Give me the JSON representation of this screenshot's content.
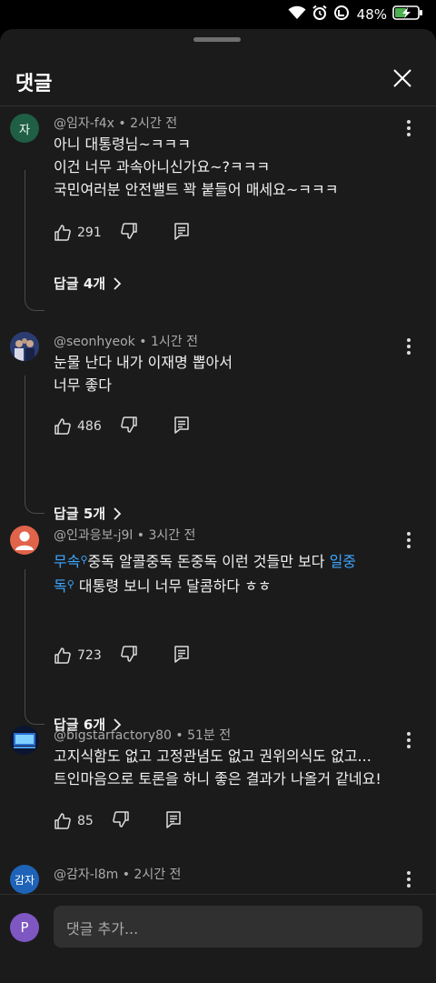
{
  "status_bar": {
    "battery": "48%"
  },
  "sheet": {
    "title": "댓글",
    "input_placeholder": "댓글 추가...",
    "input_avatar_letter": "P"
  },
  "comments": [
    {
      "avatar_letter": "자",
      "author": "@임자-f4x",
      "time": "2시간 전",
      "lines": [
        "아니 대통령님~ㅋㅋㅋ",
        "이건 너무 과속아니신가요~?ㅋㅋㅋ",
        "국민여러분 안전밸트 꽉 붙들어 매세요~ㅋㅋㅋ"
      ],
      "likes": "291",
      "replies": "답글 4개"
    },
    {
      "avatar_letter": "",
      "author": "@seonhyeok",
      "time": "1시간 전",
      "lines": [
        "눈물 난다 내가 이재명 뽑아서",
        "너무 좋다"
      ],
      "likes": "486",
      "replies": "답글 5개"
    },
    {
      "avatar_letter": "",
      "author": "@인과응보-j9l",
      "time": "3시간 전",
      "tag1": "무속",
      "text_mid": "중독 알콜중독 돈중독 이런 것들만 보다 ",
      "tag2a": "일중",
      "tag2b": "독",
      "text_end": " 대통령 보니 너무 달콤하다 ㅎㅎ",
      "likes": "723",
      "replies": "답글 6개"
    },
    {
      "avatar_letter": "",
      "author": "@bigstarfactory80",
      "time": "51분 전",
      "lines": [
        "고지식함도 없고 고정관념도 없고 권위의식도 없고...",
        "트인마음으로 토론을 하니 좋은 결과가 나올거 같네요!"
      ],
      "likes": "85"
    },
    {
      "avatar_letter": "감자",
      "author": "@감자-l8m",
      "time": "2시간 전"
    }
  ],
  "colors": {
    "sheet_bg": "#1b1b1b",
    "link": "#3ea6ff",
    "meta": "#aaaaaa"
  },
  "icons": [
    "wifi-icon",
    "alarm-icon",
    "hotspot-icon",
    "battery-charging-icon",
    "close-icon",
    "more-vert-icon",
    "like-icon",
    "dislike-icon",
    "reply-icon",
    "chevron-right-icon"
  ]
}
